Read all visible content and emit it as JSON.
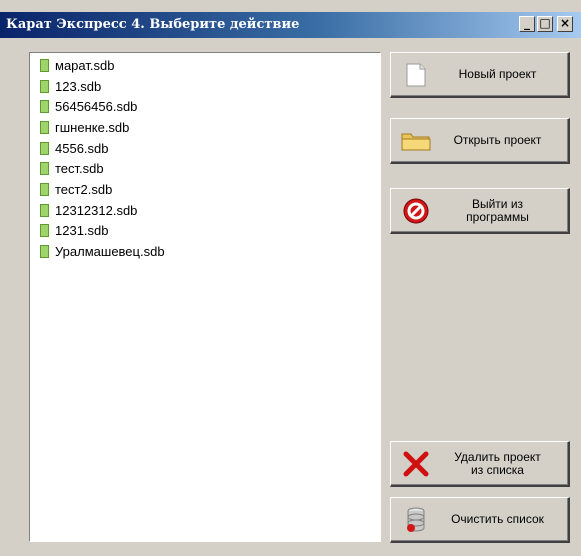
{
  "window": {
    "title": "Карат Экспресс 4. Выберите действие",
    "controls": {
      "minimize": "_",
      "maximize": "□",
      "close": "×"
    }
  },
  "files": [
    "марат.sdb",
    "123.sdb",
    "56456456.sdb",
    "гшненке.sdb",
    "4556.sdb",
    "тест.sdb",
    "тест2.sdb",
    "12312312.sdb",
    "1231.sdb",
    "Уралмашевец.sdb"
  ],
  "buttons": {
    "new_project": {
      "label": "Новый проект",
      "icon": "blank-page-icon"
    },
    "open_project": {
      "label": "Открыть проект",
      "icon": "folder-icon"
    },
    "exit": {
      "label": "Выйти из\nпрограммы",
      "icon": "stop-icon"
    },
    "remove_project": {
      "label": "Удалить проект\nиз списка",
      "icon": "red-x-icon"
    },
    "clear_list": {
      "label": "Очистить список",
      "icon": "database-icon"
    }
  },
  "colors": {
    "titlebar_start": "#0a246a",
    "titlebar_end": "#a6caf0",
    "face": "#d4d0c8"
  }
}
